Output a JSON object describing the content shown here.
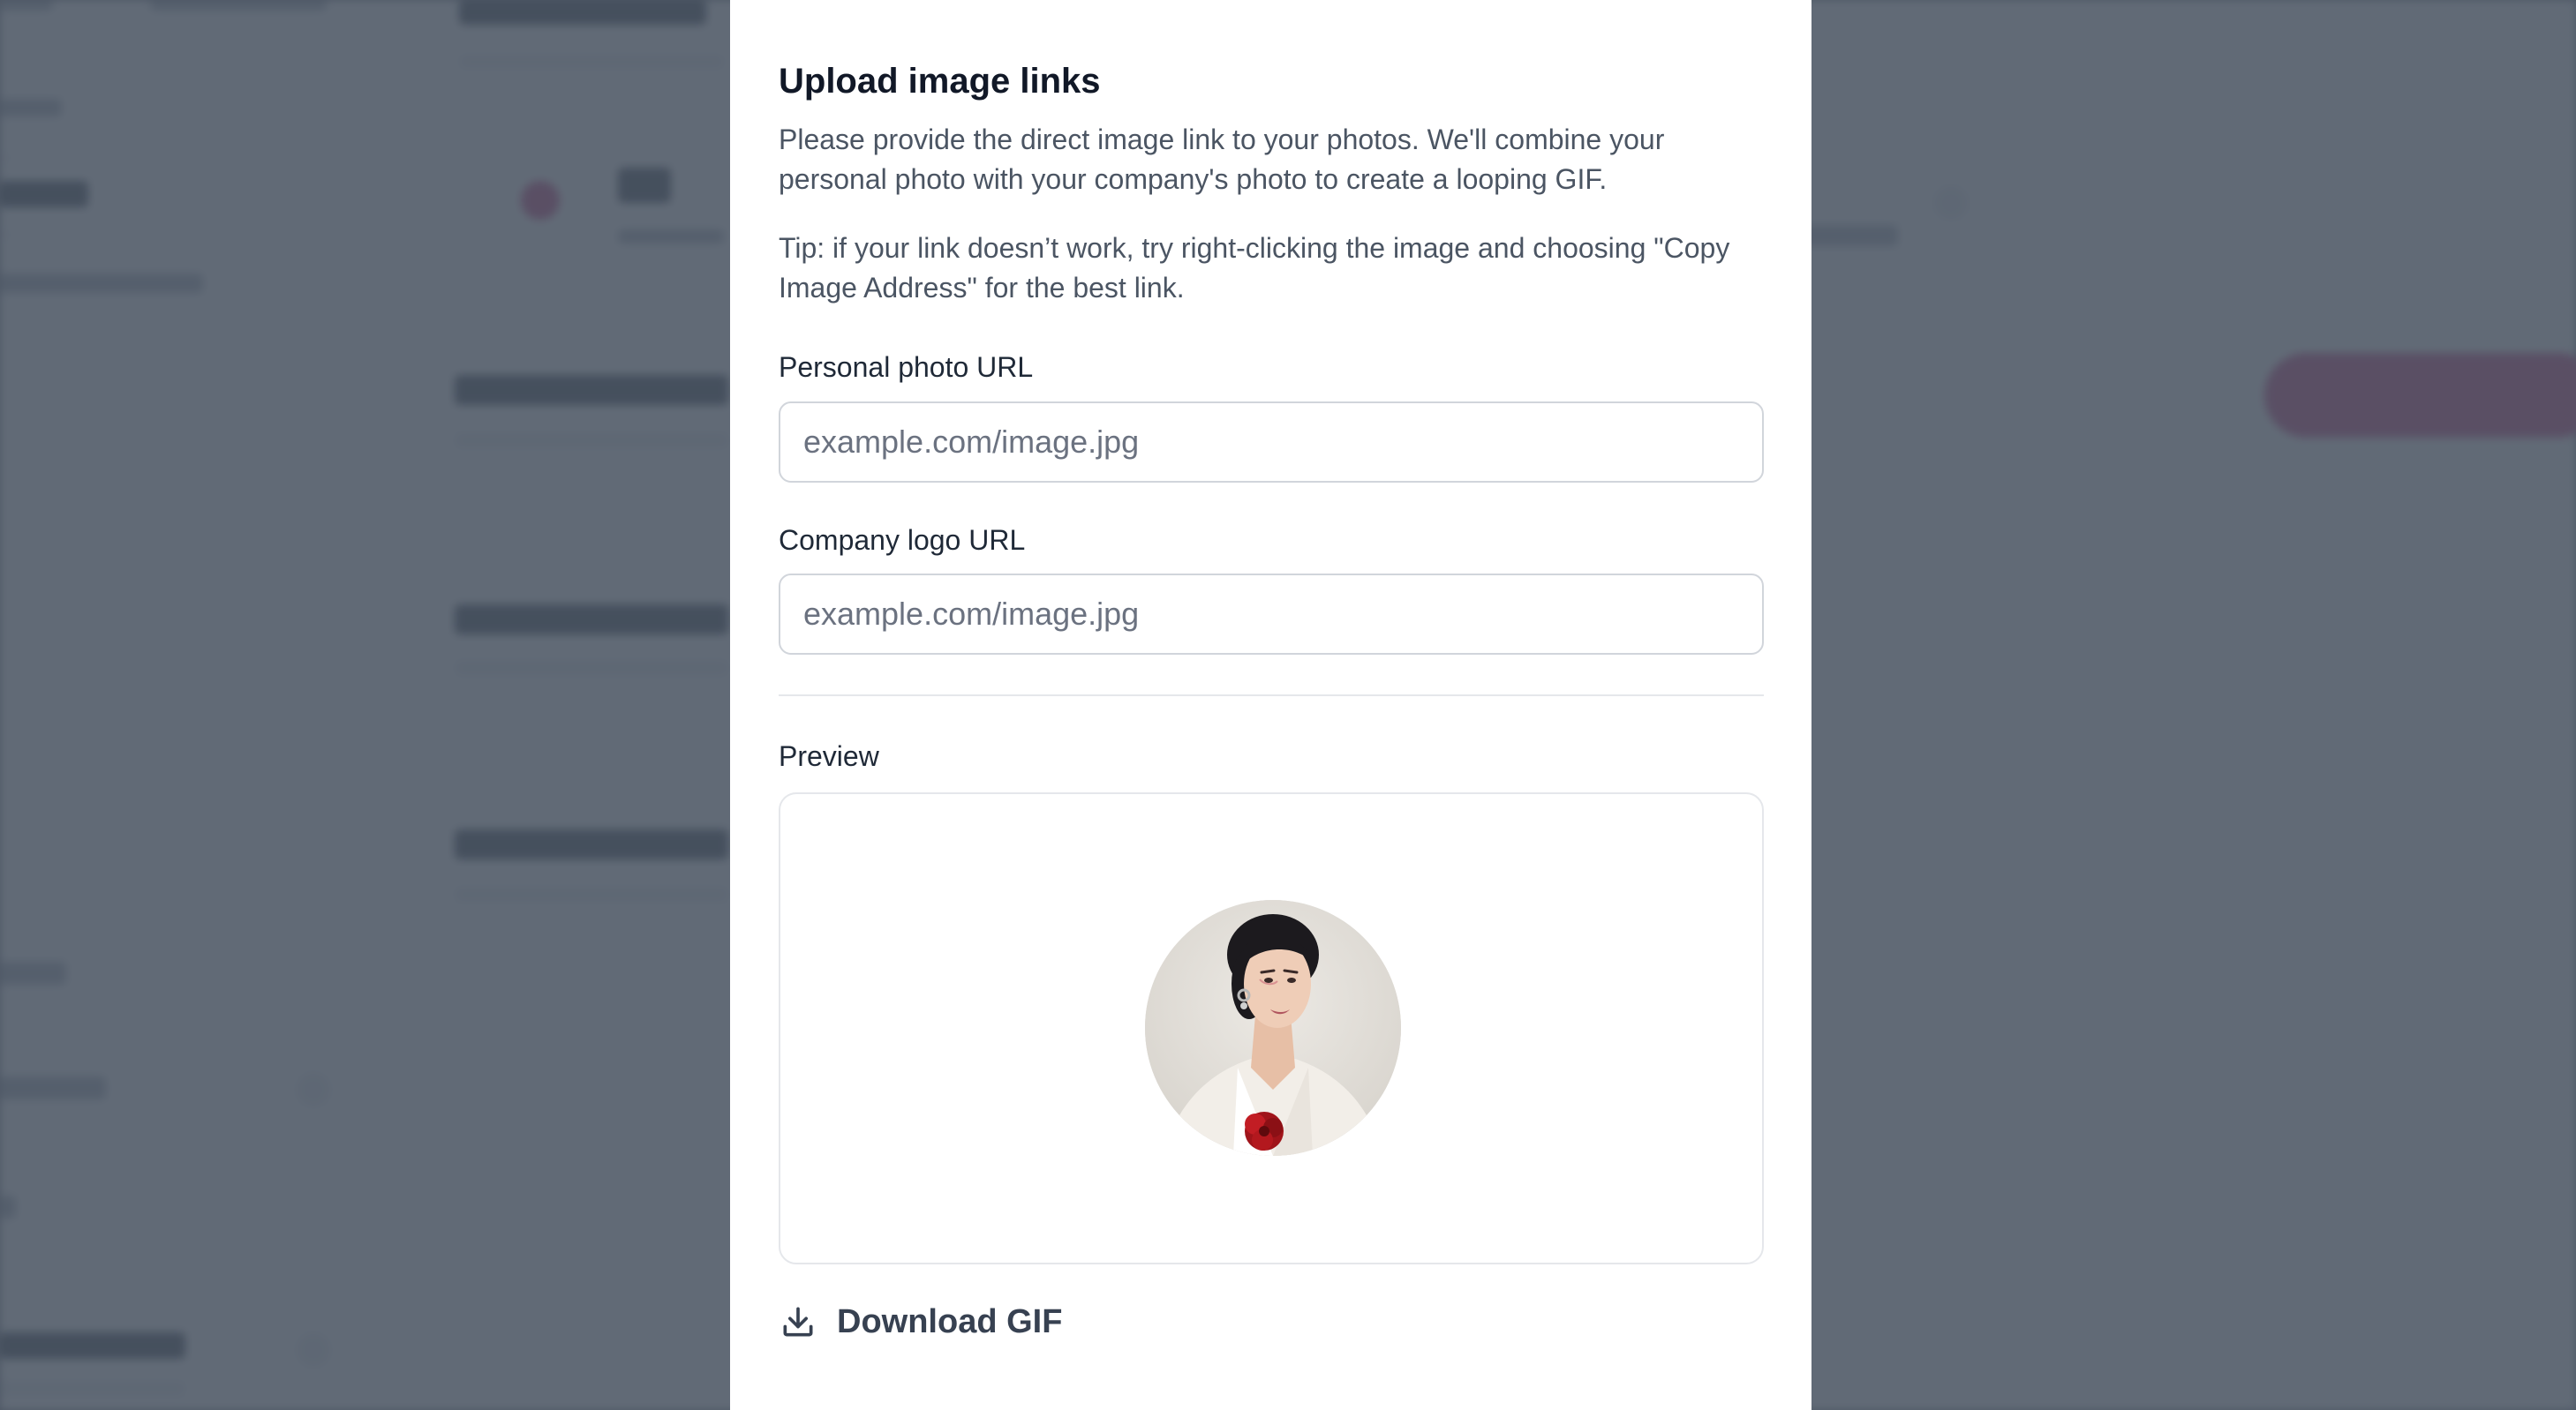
{
  "modal": {
    "title": "Upload image links",
    "description": "Please provide the direct image link to your photos. We'll combine your personal photo with your company's photo to create a looping GIF.",
    "tip": "Tip: if your link doesn’t work, try right-clicking the image and choosing \"Copy Image Address\" for the best link.",
    "personal_photo": {
      "label": "Personal photo URL",
      "value": "",
      "placeholder": "example.com/image.jpg"
    },
    "company_logo": {
      "label": "Company logo URL",
      "value": "",
      "placeholder": "example.com/image.jpg"
    },
    "preview": {
      "label": "Preview",
      "image": "portrait-photo"
    },
    "download_label": "Download GIF",
    "download_icon": "download-icon"
  },
  "colors": {
    "backdrop": "#5c6270",
    "accent": "#c0246f",
    "text_primary": "#111827",
    "text_secondary": "#4b5563"
  }
}
